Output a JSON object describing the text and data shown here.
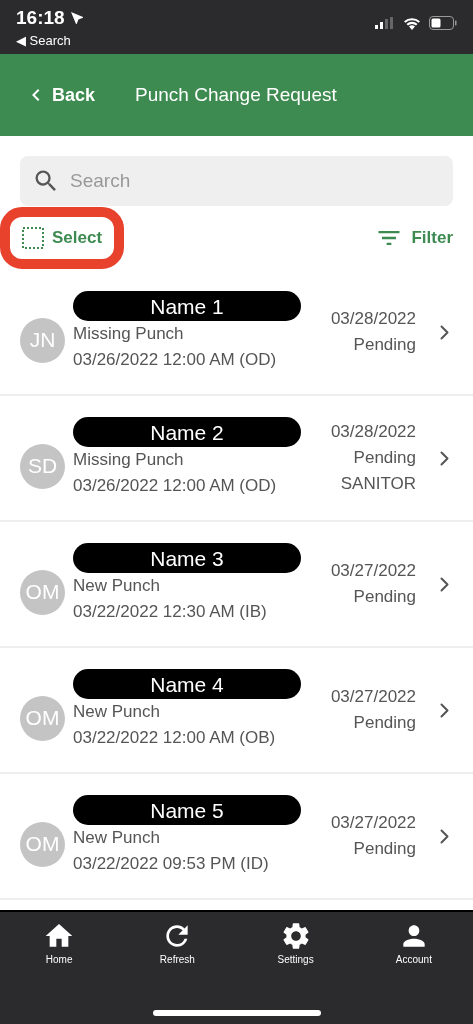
{
  "status_bar": {
    "time": "16:18",
    "back_app": "◀ Search"
  },
  "header": {
    "back": "Back",
    "title": "Punch Change Request"
  },
  "search": {
    "placeholder": "Search"
  },
  "toolbar": {
    "select": "Select",
    "select_highlighted": true,
    "filter": "Filter"
  },
  "requests": [
    {
      "initials": "JN",
      "name": "Name 1",
      "type": "Missing Punch",
      "punch": "03/26/2022 12:00 AM (OD)",
      "date": "03/28/2022",
      "status": "Pending"
    },
    {
      "initials": "SD",
      "name": "Name 2",
      "type": "Missing Punch",
      "punch": "03/26/2022 12:00 AM (OD)",
      "date": "03/28/2022",
      "status": "Pending",
      "department": "SANITOR"
    },
    {
      "initials": "OM",
      "name": "Name 3",
      "type": "New Punch",
      "punch": "03/22/2022 12:30 AM (IB)",
      "date": "03/27/2022",
      "status": "Pending"
    },
    {
      "initials": "OM",
      "name": "Name 4",
      "type": "New Punch",
      "punch": "03/22/2022 12:00 AM (OB)",
      "date": "03/27/2022",
      "status": "Pending"
    },
    {
      "initials": "OM",
      "name": "Name 5",
      "type": "New Punch",
      "punch": "03/22/2022 09:53 PM (ID)",
      "date": "03/27/2022",
      "status": "Pending"
    }
  ],
  "tab_bar": [
    {
      "kind": "home",
      "label": "Home"
    },
    {
      "kind": "refresh",
      "label": "Refresh"
    },
    {
      "kind": "settings",
      "label": "Settings"
    },
    {
      "kind": "account",
      "label": "Account"
    }
  ]
}
